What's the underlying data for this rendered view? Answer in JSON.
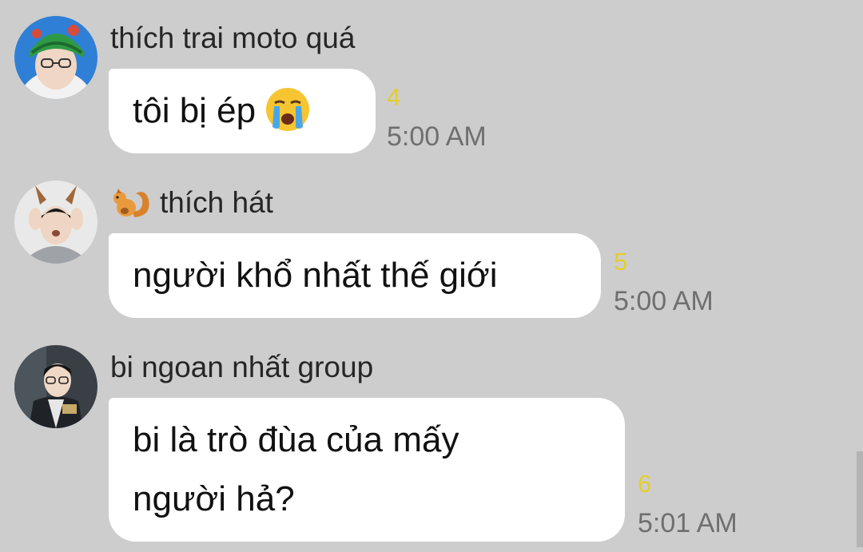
{
  "messages": [
    {
      "sender": "thích trai moto quá",
      "text_lines": [
        "tôi bị ép"
      ],
      "emoji": "crying-face-icon",
      "read_count": "4",
      "time": "5:00 AM"
    },
    {
      "sender": "thích hát",
      "sender_icon": "squirrel-icon",
      "text_lines": [
        "người khổ nhất thế giới"
      ],
      "read_count": "5",
      "time": "5:00 AM"
    },
    {
      "sender": "bi ngoan nhất group",
      "text_lines": [
        "bi là trò đùa của mấy",
        "người hả?"
      ],
      "read_count": "6",
      "time": "5:01 AM"
    }
  ],
  "colors": {
    "background": "#cdcdcd",
    "bubble": "#ffffff",
    "read_count": "#e3cf2c",
    "time": "#6f6f6f"
  }
}
